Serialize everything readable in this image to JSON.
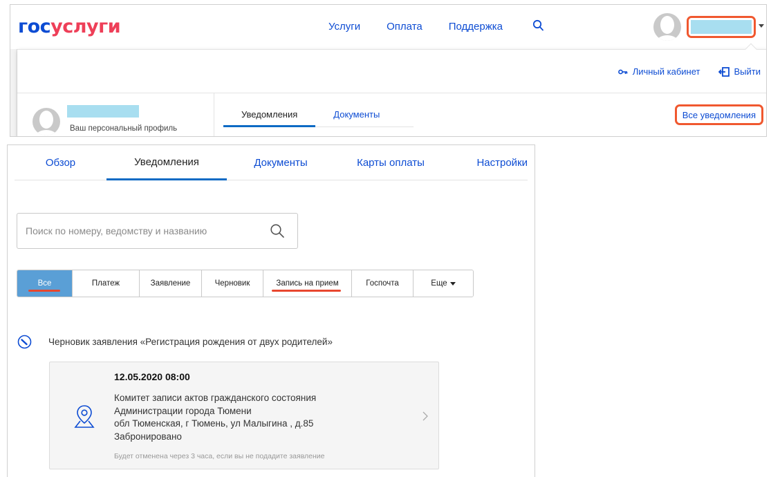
{
  "header": {
    "logo": {
      "part1": "гос",
      "part2": "услуги"
    },
    "nav": [
      "Услуги",
      "Оплата",
      "Поддержка"
    ],
    "colors": {
      "brand_blue": "#0d4cd3",
      "brand_red": "#ee3f58",
      "highlight": "#f0582f",
      "name_redaction": "#a8def0"
    }
  },
  "dropdown": {
    "actions": {
      "cabinet": "Личный кабинет",
      "logout": "Выйти"
    },
    "profile_label": "Ваш персональный профиль",
    "tabs": [
      "Уведомления",
      "Документы"
    ],
    "all_notifications": "Все уведомления"
  },
  "main": {
    "tabs": [
      "Обзор",
      "Уведомления",
      "Документы",
      "Карты оплаты",
      "Настройки"
    ],
    "search": {
      "placeholder": "Поиск по номеру, ведомству и названию",
      "value": ""
    },
    "filters": [
      "Все",
      "Платеж",
      "Заявление",
      "Черновик",
      "Запись на прием",
      "Госпочта",
      "Еще"
    ],
    "active_filter": "Все",
    "notification": {
      "title": "Черновик заявления «Регистрация рождения от двух родителей»",
      "date": "12.05.2020 08:00",
      "lines": [
        "Комитет записи актов гражданского состояния",
        "Администрации города Тюмени",
        "обл Тюменская, г Тюмень, ул Малыгина , д.85",
        "Забронировано"
      ],
      "note": "Будет отменена через 3 часа, если вы не подадите заявление"
    }
  }
}
